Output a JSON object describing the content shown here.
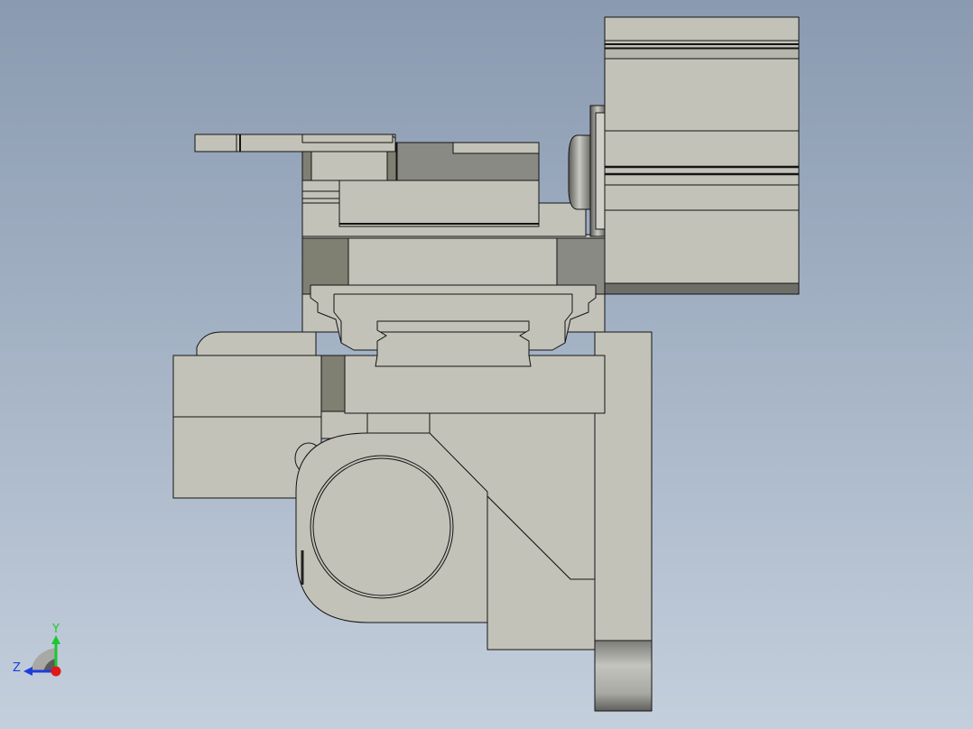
{
  "triad": {
    "y_label": "Y",
    "z_label": "Z",
    "y_color": "#19c832",
    "z_color": "#1e3cdc",
    "origin_color": "#e01818"
  },
  "palette": {
    "part_fill": "#c2c2b8",
    "part_shadow": "#7f7f72",
    "part_dark": "#8a8a84",
    "outline": "#141414"
  }
}
